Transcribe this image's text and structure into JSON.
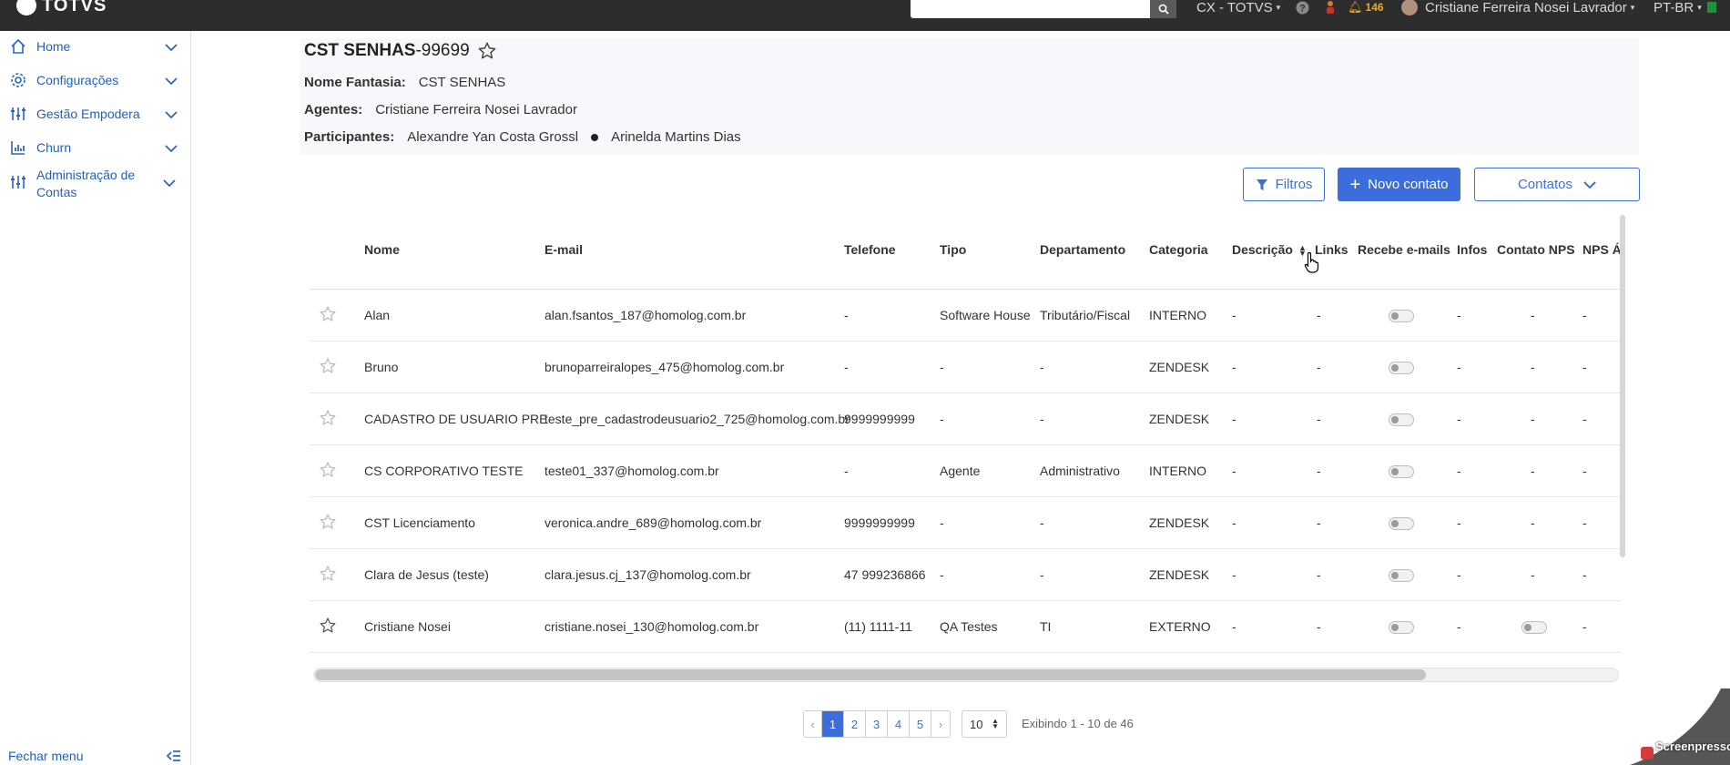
{
  "topbar": {
    "brand": "TOTVS",
    "company": "CX - TOTVS",
    "notifications": "146",
    "user": "Cristiane Ferreira Nosei Lavrador",
    "language": "PT-BR"
  },
  "sidebar": {
    "items": [
      {
        "label": "Home",
        "icon": "home-icon"
      },
      {
        "label": "Configurações",
        "icon": "gear-icon"
      },
      {
        "label": "Gestão Empodera",
        "icon": "sliders-icon"
      },
      {
        "label": "Churn",
        "icon": "chart-icon"
      },
      {
        "label": "Administração de Contas",
        "icon": "sliders-icon"
      }
    ],
    "footer_label": "Fechar menu"
  },
  "account": {
    "name": "CST SENHAS",
    "id": "-99699",
    "fantasy_label": "Nome Fantasia:",
    "fantasy_value": "CST SENHAS",
    "agents_label": "Agentes:",
    "agents_value": "Cristiane Ferreira Nosei Lavrador",
    "participants_label": "Participantes:",
    "participant_1": "Alexandre Yan Costa Grossl",
    "participant_2": "Arinelda Martins Dias"
  },
  "actions": {
    "filters": "Filtros",
    "new_contact": "Novo contato",
    "contacts": "Contatos"
  },
  "table": {
    "headers": [
      "Nome",
      "E-mail",
      "Telefone",
      "Tipo",
      "Departamento",
      "Categoria",
      "Descrição",
      "Links",
      "Recebe e-mails",
      "Infos",
      "Contato NPS",
      "NPS Á"
    ],
    "rows": [
      [
        "Alan",
        "alan.fsantos_187@homolog.com.br",
        "-",
        "Software House",
        "Tributário/Fiscal",
        "INTERNO",
        "-",
        "-",
        "-",
        "-",
        "-"
      ],
      [
        "Bruno",
        "brunoparreiralopes_475@homolog.com.br",
        "-",
        "-",
        "-",
        "ZENDESK",
        "-",
        "-",
        "-",
        "-",
        "-"
      ],
      [
        "CADASTRO DE USUARIO PRE",
        "teste_pre_cadastrodeusuario2_725@homolog.com.br",
        "9999999999",
        "-",
        "-",
        "ZENDESK",
        "-",
        "-",
        "-",
        "-",
        "-"
      ],
      [
        "CS CORPORATIVO TESTE",
        "teste01_337@homolog.com.br",
        "-",
        "Agente",
        "Administrativo",
        "INTERNO",
        "-",
        "-",
        "-",
        "-",
        "-"
      ],
      [
        "CST Licenciamento",
        "veronica.andre_689@homolog.com.br",
        "9999999999",
        "-",
        "-",
        "ZENDESK",
        "-",
        "-",
        "-",
        "-",
        "-"
      ],
      [
        "Clara de Jesus (teste)",
        "clara.jesus.cj_137@homolog.com.br",
        "47 999236866",
        "-",
        "-",
        "ZENDESK",
        "-",
        "-",
        "-",
        "-",
        "-"
      ],
      [
        "Cristiane Nosei",
        "cristiane.nosei_130@homolog.com.br",
        "(11) 1111-11",
        "QA Testes",
        "TI",
        "EXTERNO",
        "-",
        "-",
        "-",
        "",
        "-"
      ]
    ]
  },
  "pagination": {
    "prev": "‹",
    "pages": [
      "1",
      "2",
      "3",
      "4",
      "5"
    ],
    "next": "›",
    "page_size": "10",
    "showing": "Exibindo 1 - 10 de 46"
  },
  "watermark": "Screenpresso"
}
